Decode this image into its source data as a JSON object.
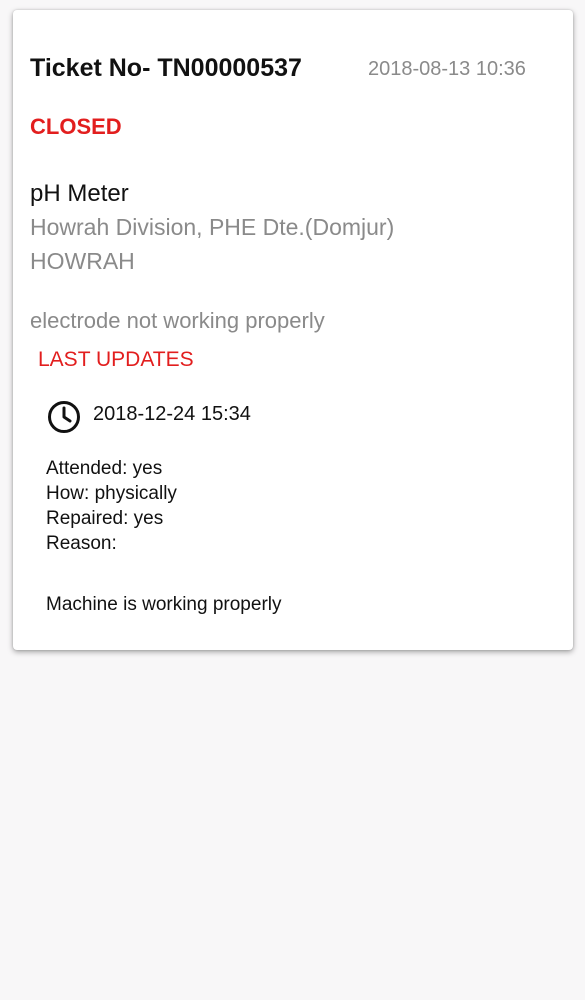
{
  "ticket": {
    "title": "Ticket No- TN00000537",
    "date": "2018-08-13 10:36",
    "status": "CLOSED",
    "device": "pH Meter",
    "division": "Howrah Division, PHE Dte.(Domjur)",
    "district": "HOWRAH",
    "problem": "electrode not working properly"
  },
  "updates": {
    "heading": "LAST UPDATES",
    "icon": "clock-icon",
    "time": "2018-12-24 15:34",
    "attended": "Attended: yes",
    "how": "How: physically",
    "repaired": "Repaired: yes",
    "reason": "Reason:",
    "remark": "Machine is working properly"
  },
  "colors": {
    "status": "#e21e1e",
    "secondary_text": "#8a8a8a",
    "primary_text": "#111111",
    "background": "#f8f7f8",
    "card": "#ffffff"
  }
}
